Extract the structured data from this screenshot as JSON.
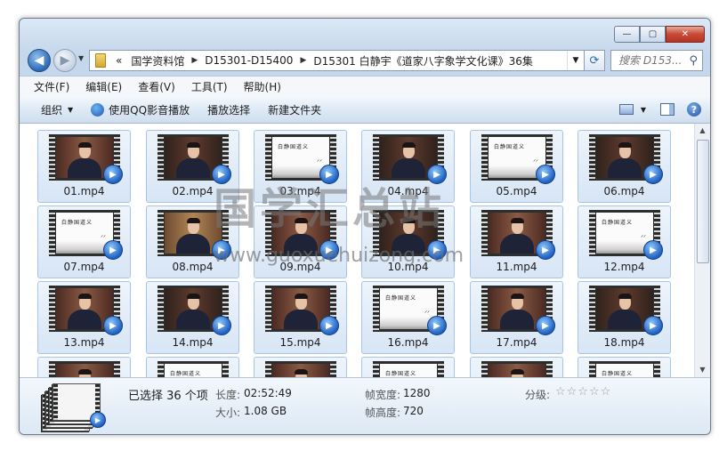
{
  "window": {
    "minimize_glyph": "—",
    "maximize_glyph": "▢",
    "close_glyph": "✕"
  },
  "nav": {
    "back_icon": "back-arrow-icon",
    "forward_icon": "forward-arrow-icon"
  },
  "address": {
    "overflow": "«",
    "crumbs": [
      "国学资料馆",
      "D15301-D15400",
      "D15301 白静宇《道家八字象学文化课》36集"
    ]
  },
  "search": {
    "placeholder": "搜索 D153..."
  },
  "menu": [
    "文件(F)",
    "编辑(E)",
    "查看(V)",
    "工具(T)",
    "帮助(H)"
  ],
  "toolbar": {
    "organize": "组织",
    "qq_play": "使用QQ影音播放",
    "play_selection": "播放选择",
    "new_folder": "新建文件夹",
    "help_glyph": "?"
  },
  "files": [
    {
      "name": "01.mp4",
      "kind": "person"
    },
    {
      "name": "02.mp4",
      "kind": "person"
    },
    {
      "name": "03.mp4",
      "kind": "white"
    },
    {
      "name": "04.mp4",
      "kind": "person"
    },
    {
      "name": "05.mp4",
      "kind": "white"
    },
    {
      "name": "06.mp4",
      "kind": "person"
    },
    {
      "name": "07.mp4",
      "kind": "white"
    },
    {
      "name": "08.mp4",
      "kind": "brown"
    },
    {
      "name": "09.mp4",
      "kind": "person"
    },
    {
      "name": "10.mp4",
      "kind": "person"
    },
    {
      "name": "11.mp4",
      "kind": "person"
    },
    {
      "name": "12.mp4",
      "kind": "white"
    },
    {
      "name": "13.mp4",
      "kind": "person"
    },
    {
      "name": "14.mp4",
      "kind": "person"
    },
    {
      "name": "15.mp4",
      "kind": "person"
    },
    {
      "name": "16.mp4",
      "kind": "white"
    },
    {
      "name": "17.mp4",
      "kind": "person"
    },
    {
      "name": "18.mp4",
      "kind": "person"
    }
  ],
  "thumb_text": "白静国道义",
  "watermark": {
    "text": "国学汇总站",
    "url": "www.guoxuehuizong.com"
  },
  "details": {
    "selected": "已选择 36 个项",
    "length_label": "长度:",
    "length_value": "02:52:49",
    "size_label": "大小:",
    "size_value": "1.08 GB",
    "width_label": "帧宽度:",
    "width_value": "1280",
    "height_label": "帧高度:",
    "height_value": "720",
    "rating_label": "分级:",
    "rating_stars": "☆☆☆☆☆",
    "rating_value": 0
  }
}
